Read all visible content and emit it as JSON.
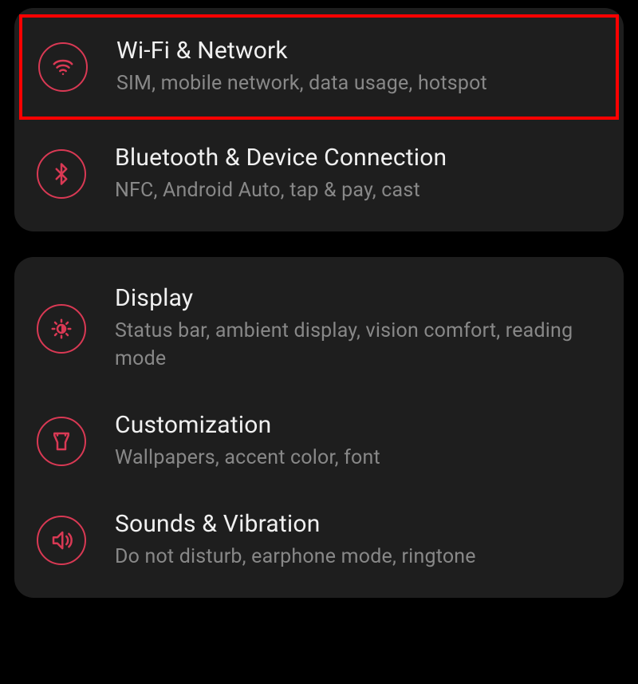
{
  "accent_color": "#d93954",
  "highlight_color": "#ff0000",
  "groups": [
    {
      "items": [
        {
          "icon": "wifi",
          "title": "Wi-Fi & Network",
          "subtitle": "SIM, mobile network, data usage, hotspot",
          "highlighted": true
        },
        {
          "icon": "bluetooth",
          "title": "Bluetooth & Device Connection",
          "subtitle": "NFC, Android Auto, tap & pay, cast",
          "highlighted": false
        }
      ]
    },
    {
      "items": [
        {
          "icon": "display",
          "title": "Display",
          "subtitle": "Status bar, ambient display, vision comfort, reading mode",
          "highlighted": false
        },
        {
          "icon": "customization",
          "title": "Customization",
          "subtitle": "Wallpapers, accent color, font",
          "highlighted": false
        },
        {
          "icon": "sounds",
          "title": "Sounds & Vibration",
          "subtitle": "Do not disturb, earphone mode, ringtone",
          "highlighted": false
        }
      ]
    }
  ]
}
